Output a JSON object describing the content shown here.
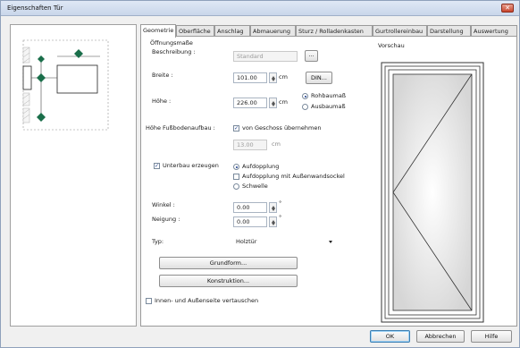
{
  "window": {
    "title": "Eigenschaften Tür",
    "close_icon": "close-icon",
    "close_glyph": "✕"
  },
  "tabs": [
    {
      "label": "Geometrie",
      "active": true
    },
    {
      "label": "Oberfläche",
      "active": false
    },
    {
      "label": "Anschlag",
      "active": false
    },
    {
      "label": "Abmauerung",
      "active": false
    },
    {
      "label": "Sturz / Rolladenkasten",
      "active": false
    },
    {
      "label": "Gurtrollereinbau",
      "active": false
    },
    {
      "label": "Darstellung",
      "active": false
    },
    {
      "label": "Auswertung",
      "active": false
    }
  ],
  "geometry": {
    "section_title": "Öffnungsmaße",
    "beschreibung_label": "Beschreibung :",
    "beschreibung_value": "Standard",
    "browse_label": "...",
    "breite_label": "Breite :",
    "breite_value": "101.00",
    "breite_unit": "cm",
    "din_label": "DIN...",
    "hoehe_label": "Höhe :",
    "hoehe_value": "226.00",
    "hoehe_unit": "cm",
    "rohbaumass_label": "Rohbaumaß",
    "ausbaumass_label": "Ausbaumaß",
    "fussboden_label": "Höhe Fußbodenaufbau :",
    "geschoss_label": "von Geschoss übernehmen",
    "fussboden_value": "13.00",
    "fussboden_unit": "cm",
    "unterbau_label": "Unterbau erzeugen",
    "aufdopplung_label": "Aufdopplung",
    "aufdopplung_sockel_label": "Aufdopplung mit Außenwandsockel",
    "schwelle_label": "Schwelle",
    "winkel_label": "Winkel :",
    "winkel_value": "0.00",
    "winkel_unit": "°",
    "neigung_label": "Neigung :",
    "neigung_value": "0.00",
    "neigung_unit": "°",
    "typ_label": "Typ:",
    "typ_value": "Holztür",
    "grundform_label": "Grundform...",
    "konstruktion_label": "Konstruktion...",
    "innen_aussen_label": "Innen- und Außenseite vertauschen",
    "preview_label": "Vorschau"
  },
  "footer": {
    "ok_label": "OK",
    "cancel_label": "Abbrechen",
    "help_label": "Hilfe"
  },
  "colors": {
    "accent": "#1a6e4a",
    "diamond": "#1a6e4a"
  }
}
